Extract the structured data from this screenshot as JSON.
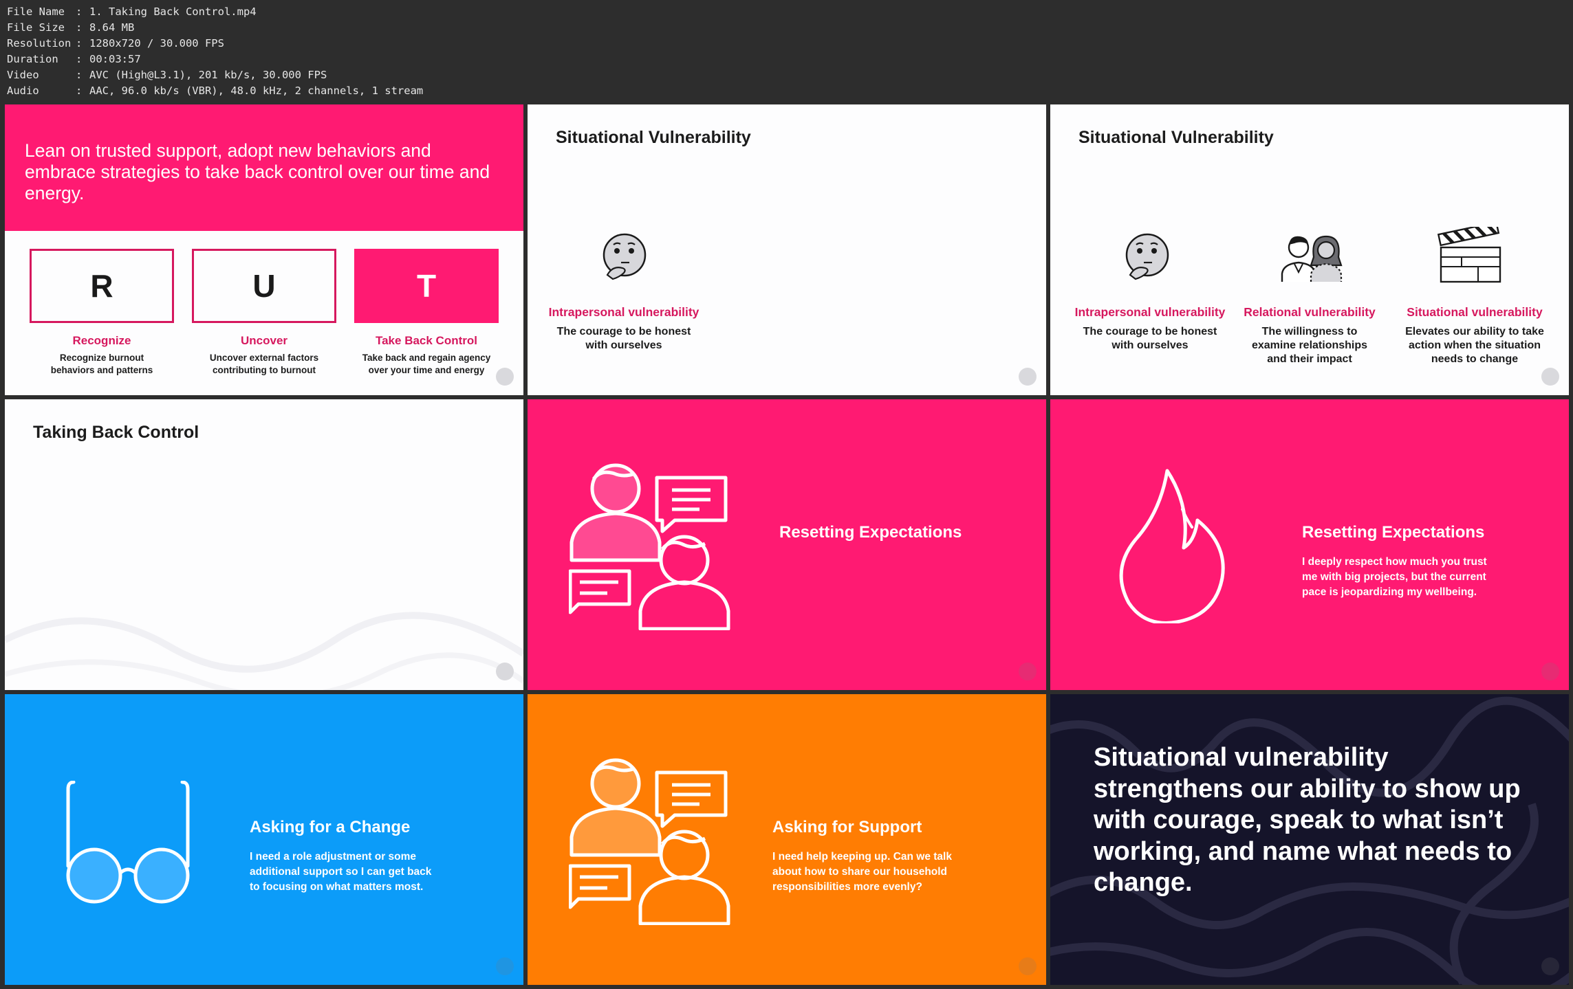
{
  "meta": [
    {
      "key": "File Name",
      "value": "1. Taking Back Control.mp4"
    },
    {
      "key": "File Size",
      "value": "8.64 MB"
    },
    {
      "key": "Resolution",
      "value": "1280x720 / 30.000 FPS"
    },
    {
      "key": "Duration",
      "value": "00:03:57"
    },
    {
      "key": "Video",
      "value": "AVC (High@L3.1), 201 kb/s, 30.000 FPS"
    },
    {
      "key": "Audio",
      "value": "AAC, 96.0 kb/s (VBR), 48.0 kHz, 2 channels, 1 stream"
    }
  ],
  "colors": {
    "pink": "#ff1a72",
    "deep_pink": "#d6185e",
    "blue": "#0c9cf9",
    "orange": "#ff7d03",
    "navy": "#15142a"
  },
  "tile1": {
    "banner": "Lean on trusted support, adopt new behaviors and embrace strategies to take back control over our time and energy.",
    "items": [
      {
        "letter": "R",
        "label": "Recognize",
        "desc1": "Recognize burnout",
        "desc2": "behaviors and patterns"
      },
      {
        "letter": "U",
        "label": "Uncover",
        "desc1": "Uncover external factors",
        "desc2": "contributing to burnout"
      },
      {
        "letter": "T",
        "label": "Take Back Control",
        "desc1": "Take back and regain agency",
        "desc2": "over your time and energy"
      }
    ]
  },
  "tile2": {
    "title": "Situational Vulnerability",
    "label": "Intrapersonal vulnerability",
    "desc1": "The courage to be honest",
    "desc2": "with ourselves",
    "icon": "thinking-face-icon"
  },
  "tile3": {
    "title": "Situational Vulnerability",
    "cols": [
      {
        "label": "Intrapersonal vulnerability",
        "lines": [
          "The courage to be honest",
          "with ourselves"
        ],
        "icon": "thinking-face-icon"
      },
      {
        "label": "Relational vulnerability",
        "lines": [
          "The willingness to",
          "examine relationships",
          "and their impact"
        ],
        "icon": "two-people-icon"
      },
      {
        "label": "Situational vulnerability",
        "lines": [
          "Elevates our ability to take",
          "action when the situation",
          "needs to change"
        ],
        "icon": "clapperboard-icon"
      }
    ]
  },
  "tile4": {
    "title": "Taking Back Control"
  },
  "tile5": {
    "title": "Resetting Expectations",
    "icon": "conversation-icon"
  },
  "tile6": {
    "title": "Resetting Expectations",
    "lines": [
      "I deeply respect how much you trust",
      "me with big projects, but the current",
      "pace is jeopardizing my wellbeing."
    ],
    "icon": "flame-icon"
  },
  "tile7": {
    "title": "Asking for a Change",
    "lines": [
      "I need a role adjustment or some",
      "additional support so I can get back",
      "to focusing on what matters most."
    ],
    "icon": "glasses-icon"
  },
  "tile8": {
    "title": "Asking for Support",
    "lines": [
      "I need help keeping up. Can we talk",
      "about how to share our household",
      "responsibilities more evenly?"
    ],
    "icon": "conversation-icon"
  },
  "tile9": {
    "text": "Situational vulnerability strengthens our ability to show up with courage, speak to what isn’t working, and name what needs to change."
  }
}
